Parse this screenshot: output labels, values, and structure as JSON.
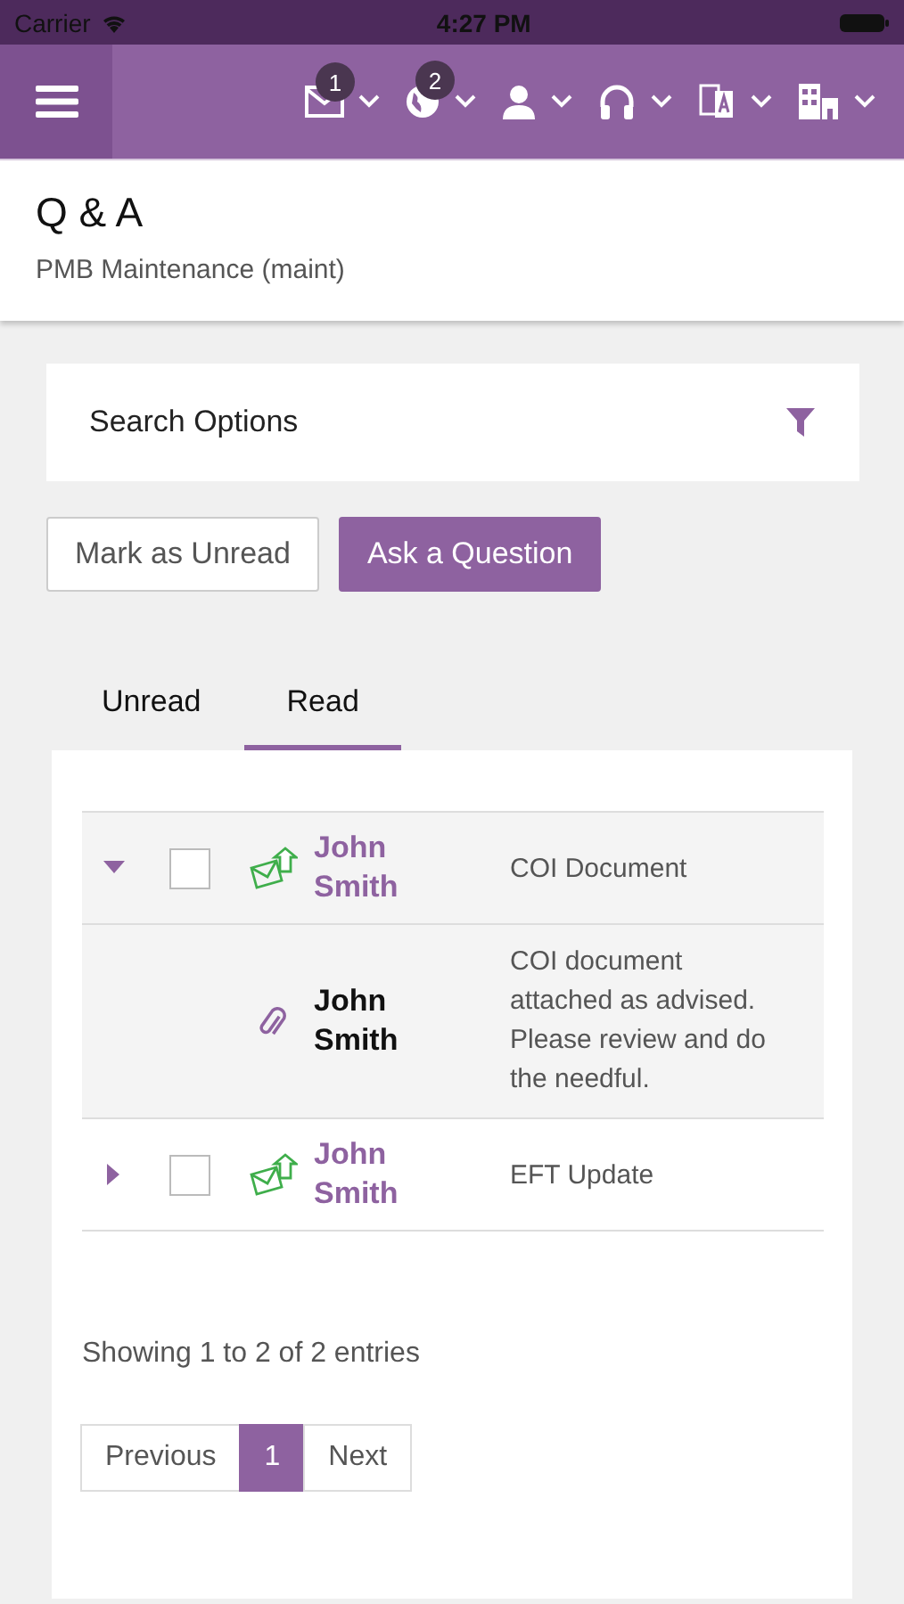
{
  "status_bar": {
    "carrier": "Carrier",
    "time": "4:27 PM"
  },
  "nav": {
    "icons": [
      {
        "kind": "mail",
        "badge": "1"
      },
      {
        "kind": "globe",
        "badge": "2"
      },
      {
        "kind": "person"
      },
      {
        "kind": "headset"
      },
      {
        "kind": "translate"
      },
      {
        "kind": "building"
      }
    ]
  },
  "header": {
    "title": "Q & A",
    "subtitle": "PMB Maintenance (maint)"
  },
  "search_options": {
    "label": "Search Options"
  },
  "buttons": [
    {
      "label": "Mark as Unread",
      "kind": "outline"
    },
    {
      "label": "Ask a Question",
      "kind": "primary"
    }
  ],
  "tabs": [
    {
      "label": "Unread",
      "selected": false
    },
    {
      "label": "Read",
      "selected": true
    }
  ],
  "rows": [
    {
      "kind": "message",
      "expanded": true,
      "checked": false,
      "sender": "John Smith",
      "subject": "COI Document"
    },
    {
      "kind": "detail",
      "sender": "John Smith",
      "body": "COI document attached as advised. Please review and do the needful."
    },
    {
      "kind": "message",
      "expanded": false,
      "checked": false,
      "sender": "John Smith",
      "subject": "EFT Update"
    }
  ],
  "summary": "Showing 1 to 2 of 2 entries",
  "pagination": [
    {
      "label": "Previous",
      "selected": false
    },
    {
      "label": "1",
      "selected": true
    },
    {
      "label": "Next",
      "selected": false
    }
  ]
}
